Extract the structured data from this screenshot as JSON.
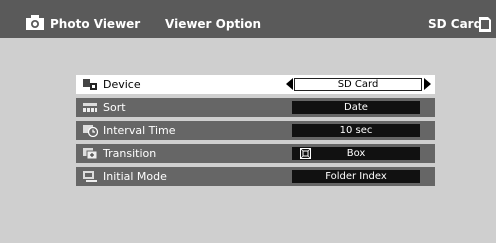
{
  "header": {
    "app_title": "Photo Viewer",
    "section_title": "Viewer Option",
    "media_label": "SD Card",
    "app_icon": "camera-icon",
    "media_icon": "sd-card-icon"
  },
  "menu": {
    "items": [
      {
        "label": "Device",
        "value": "SD Card",
        "icon": "device-icon",
        "selected": true
      },
      {
        "label": "Sort",
        "value": "Date",
        "icon": "sort-icon",
        "selected": false
      },
      {
        "label": "Interval Time",
        "value": "10 sec",
        "icon": "interval-time-icon",
        "selected": false
      },
      {
        "label": "Transition",
        "value": "Box",
        "icon": "transition-icon",
        "selected": false
      },
      {
        "label": "Initial Mode",
        "value": "Folder Index",
        "icon": "initial-mode-icon",
        "selected": false
      }
    ]
  },
  "colors": {
    "header_bg": "#5a5a5a",
    "screen_bg": "#cfcfcf",
    "row_bg": "#666666",
    "value_bg": "#111111",
    "selected_bg": "#ffffff"
  }
}
